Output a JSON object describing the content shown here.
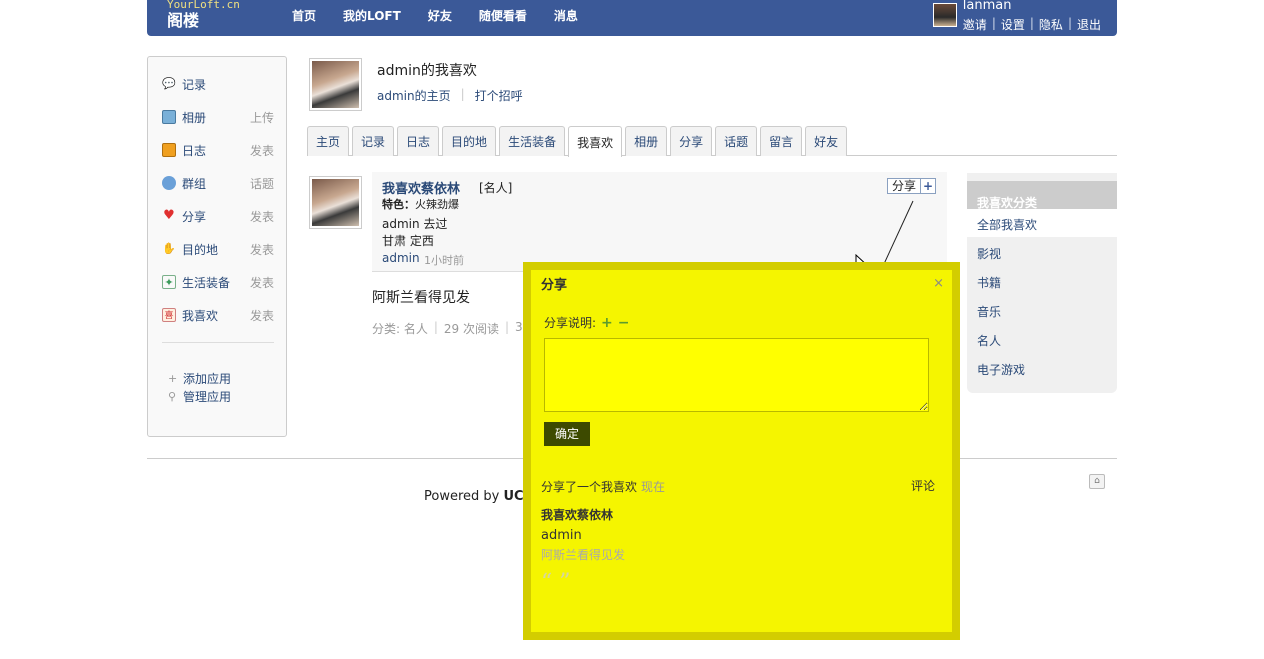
{
  "header": {
    "logo_small": "YourLoft.cn",
    "logo_big": "阁楼",
    "nav": [
      "首页",
      "我的LOFT",
      "好友",
      "随便看看",
      "消息"
    ],
    "username": "lanman",
    "user_links": [
      "邀请",
      "设置",
      "隐私",
      "退出"
    ]
  },
  "sidebar": {
    "apps": [
      {
        "label": "记录",
        "action": "",
        "icon": "speech-bubble-icon"
      },
      {
        "label": "相册",
        "action": "上传",
        "icon": "photo-icon"
      },
      {
        "label": "日志",
        "action": "发表",
        "icon": "notebook-icon"
      },
      {
        "label": "群组",
        "action": "话题",
        "icon": "people-icon"
      },
      {
        "label": "分享",
        "action": "发表",
        "icon": "heart-icon"
      },
      {
        "label": "目的地",
        "action": "发表",
        "icon": "hand-icon"
      },
      {
        "label": "生活装备",
        "action": "发表",
        "icon": "gear-icon"
      },
      {
        "label": "我喜欢",
        "action": "发表",
        "icon": "like-icon"
      }
    ],
    "add_app": "添加应用",
    "manage_app": "管理应用"
  },
  "profile": {
    "title": "admin的我喜欢",
    "home_link": "admin的主页",
    "greet_link": "打个招呼"
  },
  "tabs": [
    "主页",
    "记录",
    "日志",
    "目的地",
    "生活装备",
    "我喜欢",
    "相册",
    "分享",
    "话题",
    "留言",
    "好友"
  ],
  "active_tab": "我喜欢",
  "feed": {
    "title": "我喜欢蔡依林",
    "tag": "[名人]",
    "feature_label": "特色：",
    "feature_value": "火辣劲爆",
    "line1": "admin 去过",
    "line2": "甘肃 定西",
    "author": "admin",
    "time": "1小时前",
    "share_label": "分享",
    "share_plus": "+",
    "body": "阿斯兰看得见发",
    "meta_category": "分类: 名人",
    "meta_reads": "29 次阅读",
    "meta_more": "3"
  },
  "categories": {
    "title": "我喜欢分类",
    "items": [
      "全部我喜欢",
      "影视",
      "书籍",
      "音乐",
      "名人",
      "电子游戏"
    ]
  },
  "footer": {
    "powered_prefix": "Powered by ",
    "powered_brand": "UC"
  },
  "dialog": {
    "title": "分享",
    "close": "×",
    "desc_label": "分享说明:",
    "desc_add": "+",
    "desc_remove": "−",
    "textarea_value": "",
    "ok": "确定",
    "shared_text": "分享了一个我喜欢",
    "shared_time": "现在",
    "comment": "评论",
    "item_title": "我喜欢蔡依林",
    "item_author": "admin",
    "item_body": "阿斯兰看得见发",
    "quotes": "“ ”"
  }
}
